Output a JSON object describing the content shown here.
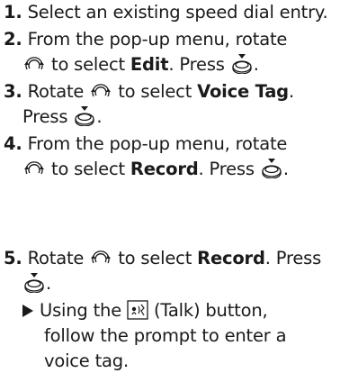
{
  "steps": [
    {
      "number": "1.",
      "line1": "Select an existing speed dial entry."
    },
    {
      "number": "2.",
      "line1": "From the pop-up menu, rotate",
      "pre": "to select",
      "item": "Edit",
      "post": ". Press",
      "end": "."
    },
    {
      "number": "3.",
      "pre1": "Rotate",
      "mid1": "to select",
      "item": "Voice Tag",
      "post1": ".",
      "line2": "Press",
      "end": "."
    },
    {
      "number": "4.",
      "line1": "From the pop-up menu, rotate",
      "pre": "to select",
      "item": "Record",
      "post": ". Press",
      "end": "."
    },
    {
      "number": "5.",
      "pre1": "Rotate",
      "mid1": "to select",
      "item": "Record",
      "post1": ". Press",
      "end": "."
    }
  ],
  "result": {
    "pre": "Using the",
    "post": "(Talk) button,",
    "line2": "follow the prompt to enter a",
    "line3": "voice tag."
  },
  "icons": {
    "rotate": "selector-knob-rotate-icon",
    "press": "selector-knob-press-icon",
    "talk": "talk-button-icon",
    "arrow": "result-arrow-icon"
  },
  "colors": {
    "text": "#1a1a1a"
  }
}
